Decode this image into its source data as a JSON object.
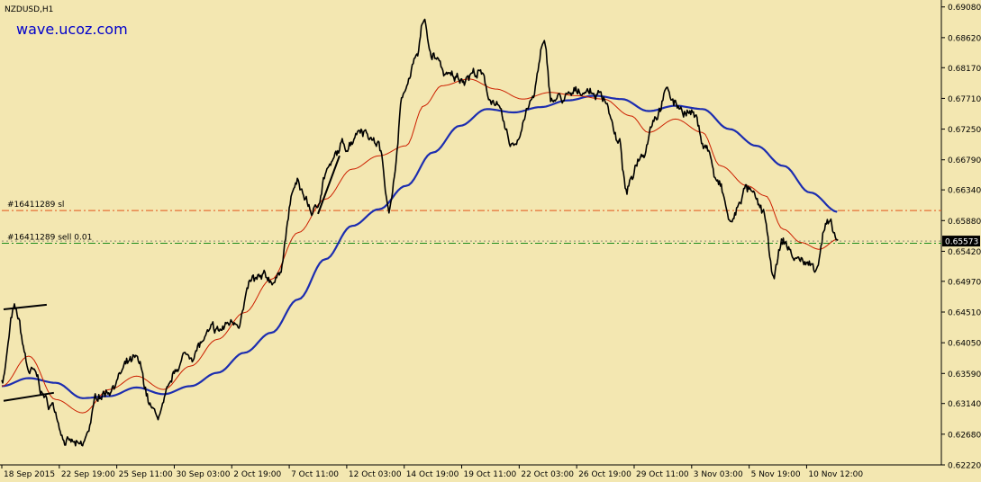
{
  "chart_data": {
    "type": "line",
    "symbol": "NZDUSD,H1",
    "watermark": "wave.ucoz.com",
    "current_price": 0.65573,
    "price_tag": "0.65573",
    "ylim": [
      0.6222,
      0.6913
    ],
    "y_ticks": [
      "0.69080",
      "0.68620",
      "0.68170",
      "0.67710",
      "0.67250",
      "0.66790",
      "0.66340",
      "0.65880",
      "0.65420",
      "0.64970",
      "0.64510",
      "0.64050",
      "0.63590",
      "0.63140",
      "0.62680",
      "0.62220"
    ],
    "y_tick_values": [
      0.6908,
      0.6862,
      0.6817,
      0.6771,
      0.6725,
      0.6679,
      0.6634,
      0.6588,
      0.6542,
      0.6497,
      0.6451,
      0.6405,
      0.6359,
      0.6314,
      0.6268,
      0.6222
    ],
    "x_labels": [
      "18 Sep 2015",
      "22 Sep 19:00",
      "25 Sep 11:00",
      "30 Sep 03:00",
      "2 Oct 19:00",
      "7 Oct 11:00",
      "12 Oct 03:00",
      "14 Oct 19:00",
      "19 Oct 11:00",
      "22 Oct 03:00",
      "26 Oct 19:00",
      "29 Oct 11:00",
      "3 Nov 03:00",
      "5 Nov 19:00",
      "10 Nov 12:00"
    ],
    "x_label_index": [
      0,
      64,
      128,
      192,
      256,
      320,
      384,
      448,
      512,
      576,
      640,
      704,
      768,
      832,
      896
    ],
    "levels": [
      {
        "label": "#16411289 sl",
        "value": 0.6603,
        "color": "#e2541b"
      },
      {
        "label": "#16411289 sell 0.01",
        "value": 0.6554,
        "color": "#1a8c1a"
      }
    ],
    "price_keypoints": [
      [
        0,
        0.6352
      ],
      [
        14,
        0.645
      ],
      [
        32,
        0.636
      ],
      [
        55,
        0.631
      ],
      [
        75,
        0.6255
      ],
      [
        88,
        0.6245
      ],
      [
        110,
        0.633
      ],
      [
        148,
        0.6375
      ],
      [
        172,
        0.6295
      ],
      [
        205,
        0.6385
      ],
      [
        238,
        0.642
      ],
      [
        262,
        0.644
      ],
      [
        280,
        0.6495
      ],
      [
        305,
        0.65
      ],
      [
        328,
        0.664
      ],
      [
        348,
        0.66
      ],
      [
        362,
        0.6665
      ],
      [
        382,
        0.67
      ],
      [
        400,
        0.673
      ],
      [
        418,
        0.6705
      ],
      [
        432,
        0.6615
      ],
      [
        448,
        0.678
      ],
      [
        462,
        0.684
      ],
      [
        470,
        0.6885
      ],
      [
        478,
        0.6835
      ],
      [
        500,
        0.68
      ],
      [
        530,
        0.681
      ],
      [
        546,
        0.677
      ],
      [
        568,
        0.67
      ],
      [
        590,
        0.6765
      ],
      [
        603,
        0.685
      ],
      [
        612,
        0.677
      ],
      [
        630,
        0.677
      ],
      [
        648,
        0.6785
      ],
      [
        670,
        0.6775
      ],
      [
        688,
        0.67
      ],
      [
        695,
        0.663
      ],
      [
        712,
        0.669
      ],
      [
        728,
        0.675
      ],
      [
        740,
        0.678
      ],
      [
        752,
        0.676
      ],
      [
        768,
        0.675
      ],
      [
        784,
        0.67
      ],
      [
        798,
        0.664
      ],
      [
        812,
        0.6585
      ],
      [
        828,
        0.6635
      ],
      [
        848,
        0.66
      ],
      [
        858,
        0.6505
      ],
      [
        870,
        0.6555
      ],
      [
        885,
        0.653
      ],
      [
        905,
        0.652
      ],
      [
        918,
        0.6582
      ],
      [
        931,
        0.6557
      ]
    ],
    "ma_fast_keypoints": [
      [
        0,
        0.634
      ],
      [
        30,
        0.6385
      ],
      [
        60,
        0.632
      ],
      [
        90,
        0.63
      ],
      [
        120,
        0.6335
      ],
      [
        150,
        0.6355
      ],
      [
        180,
        0.6335
      ],
      [
        210,
        0.637
      ],
      [
        240,
        0.641
      ],
      [
        270,
        0.645
      ],
      [
        300,
        0.65
      ],
      [
        330,
        0.657
      ],
      [
        360,
        0.662
      ],
      [
        390,
        0.6665
      ],
      [
        420,
        0.6685
      ],
      [
        450,
        0.67
      ],
      [
        470,
        0.676
      ],
      [
        490,
        0.679
      ],
      [
        520,
        0.68
      ],
      [
        550,
        0.6785
      ],
      [
        580,
        0.677
      ],
      [
        610,
        0.678
      ],
      [
        640,
        0.6775
      ],
      [
        670,
        0.677
      ],
      [
        700,
        0.6745
      ],
      [
        720,
        0.672
      ],
      [
        750,
        0.674
      ],
      [
        780,
        0.672
      ],
      [
        800,
        0.667
      ],
      [
        830,
        0.664
      ],
      [
        850,
        0.6625
      ],
      [
        870,
        0.6575
      ],
      [
        890,
        0.6555
      ],
      [
        910,
        0.6545
      ],
      [
        931,
        0.656
      ]
    ],
    "ma_slow_keypoints": [
      [
        0,
        0.634
      ],
      [
        30,
        0.6352
      ],
      [
        60,
        0.6345
      ],
      [
        90,
        0.6322
      ],
      [
        120,
        0.6325
      ],
      [
        150,
        0.6338
      ],
      [
        180,
        0.6328
      ],
      [
        210,
        0.634
      ],
      [
        240,
        0.636
      ],
      [
        270,
        0.639
      ],
      [
        300,
        0.642
      ],
      [
        330,
        0.647
      ],
      [
        360,
        0.653
      ],
      [
        390,
        0.658
      ],
      [
        420,
        0.6605
      ],
      [
        450,
        0.664
      ],
      [
        480,
        0.669
      ],
      [
        510,
        0.673
      ],
      [
        540,
        0.6755
      ],
      [
        570,
        0.675
      ],
      [
        600,
        0.6758
      ],
      [
        630,
        0.6768
      ],
      [
        660,
        0.6775
      ],
      [
        690,
        0.677
      ],
      [
        720,
        0.6752
      ],
      [
        750,
        0.676
      ],
      [
        780,
        0.6755
      ],
      [
        810,
        0.6725
      ],
      [
        840,
        0.67
      ],
      [
        870,
        0.667
      ],
      [
        900,
        0.663
      ],
      [
        931,
        0.6601
      ]
    ],
    "series": [
      {
        "values_from": "price_keypoints",
        "color": "#000000"
      },
      {
        "values_from": "ma_fast_keypoints",
        "color": "#cc1f00"
      },
      {
        "values_from": "ma_slow_keypoints",
        "color": "#1c2db0"
      }
    ],
    "grid": false
  }
}
